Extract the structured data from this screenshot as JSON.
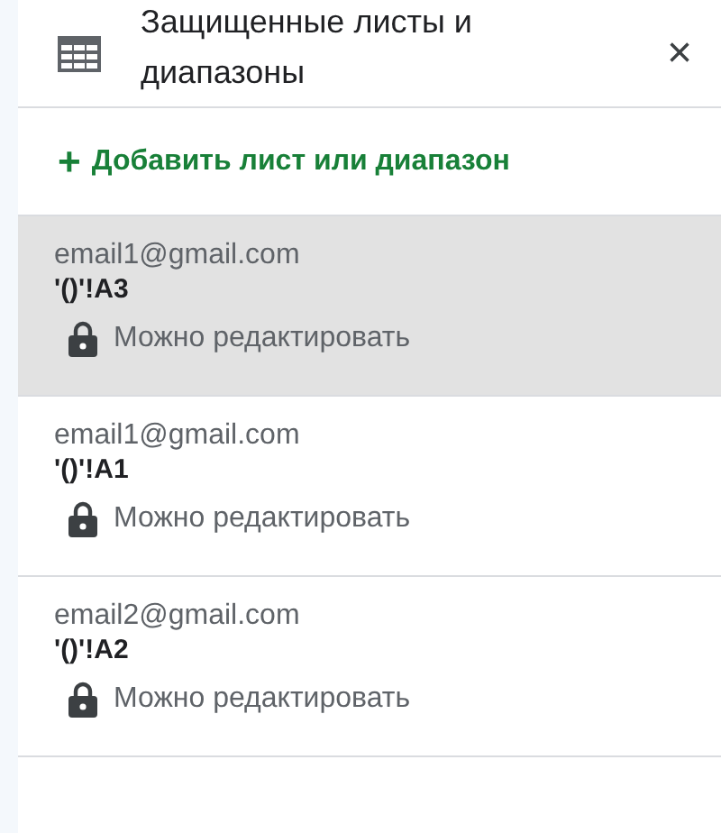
{
  "header": {
    "title": "Защищенные листы и диапазоны",
    "close": "×"
  },
  "add_button": {
    "icon": "+",
    "label": "Добавить лист или диапазон"
  },
  "ranges": [
    {
      "owner": "email1@gmail.com",
      "range": "'()'!A3",
      "permission": "Можно редактировать",
      "selected": true
    },
    {
      "owner": "email1@gmail.com",
      "range": "'()'!A1",
      "permission": "Можно редактировать",
      "selected": false
    },
    {
      "owner": "email2@gmail.com",
      "range": "'()'!A2",
      "permission": "Можно редактировать",
      "selected": false
    }
  ]
}
